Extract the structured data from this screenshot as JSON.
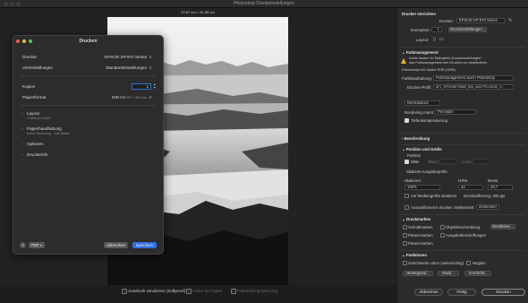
{
  "window": {
    "title": "Photoshop Druckeinstellungen"
  },
  "preview": {
    "dimensions": "29,67 cm × 41,98 cm"
  },
  "print_dialog": {
    "title": "Drucken",
    "printer_label": "Drucker",
    "printer_value": "EPSON XP-970 Series",
    "presets_label": "Voreinstellungen",
    "presets_value": "Standardeinstellungen",
    "copies_label": "Kopien",
    "copies_value": "1",
    "paper_label": "Papierformat",
    "paper_value": "DIN A3",
    "paper_size": "297 × 420 mm",
    "sections": [
      {
        "title": "Layout",
        "subtitle": "1 Seite pro Blatt"
      },
      {
        "title": "Papierhandhabung",
        "subtitle": "Keine Sortierung – Alle Blätter"
      },
      {
        "title": "Optionen",
        "subtitle": ""
      },
      {
        "title": "Druckerinfo",
        "subtitle": ""
      }
    ],
    "help_label": "?",
    "pdf_label": "PDF",
    "cancel_label": "Abbrechen",
    "save_label": "Speichern"
  },
  "bottom_bar": {
    "simulate_label": "Ausdruck simulieren (Softproof)",
    "paper_color_label": "Farbe für Papier",
    "gamut_label": "Farbumfang-Warnung"
  },
  "panel": {
    "printer_setup_title": "Drucker einrichten",
    "printer_label": "Drucker:",
    "printer_value": "EPSON XP-970 Series",
    "copies_label": "Exemplare:",
    "copies_value": "1",
    "print_settings_button": "Druckeinstellungen...",
    "layout_label": "Layout:",
    "color_management_title": "Farbmanagement",
    "warning_line1": "Achte darauf, im Dialogfeld „Druckeinstellungen“",
    "warning_line2": "das Farbmanagement des Druckers zu deaktivieren.",
    "profile_line": "Dokumentprofil: Adobe RGB (1998)",
    "color_handling_label": "Farbhandhabung:",
    "color_handling_value": "Farbmanagement durch Photoshop",
    "printer_profile_label": "Drucker-Profil:",
    "printer_profile_value": "AF1_EPSONET8985_D84_MATTPLUS240_S...",
    "normal_print_value": "Normaldruck",
    "rendering_label": "Rendering Intent:",
    "rendering_value": "Perzeptiv",
    "depth_comp_label": "Tiefenkompensierung",
    "description_title": "Beschreibung",
    "position_title": "Position und Größe",
    "position_label": "Position",
    "center_label": "Mitte",
    "top_label": "Oben:",
    "left_label": "Links:",
    "scaled_size_label": "Skalierte Ausgabegröße",
    "scale_label": "Skalieren:",
    "scale_value": "100%",
    "height_label": "Höhe:",
    "height_value": "42",
    "width_label": "Breite:",
    "width_value": "29,7",
    "fit_media_label": "Auf Mediengröße skalieren",
    "resolution_text": "Druckauflösung: 300 ppi",
    "print_selection_label": "Auswahlbereich drucken",
    "units_label": "Maßeinheit:",
    "units_value": "Zentimeter",
    "print_marks_title": "Druckmarken",
    "crop_marks_label": "Schnittmarken",
    "object_desc_label": "Objektbeschreibung",
    "edit_button": "Bearbeiten...",
    "corner_marks_label": "Passermarken",
    "print_labels_label": "Ausgabebeschriftungen",
    "registration_label": "Passermarken",
    "functions_title": "Funktionen",
    "emulsion_label": "Schichtseite unten (seitenrichtig)",
    "negative_label": "Negativ",
    "background_button": "Hintergrund...",
    "border_button": "Rand...",
    "bleed_button": "Anschnitt...",
    "cancel_label": "Abbrechen",
    "done_label": "Fertig",
    "print_label": "Drucken"
  }
}
